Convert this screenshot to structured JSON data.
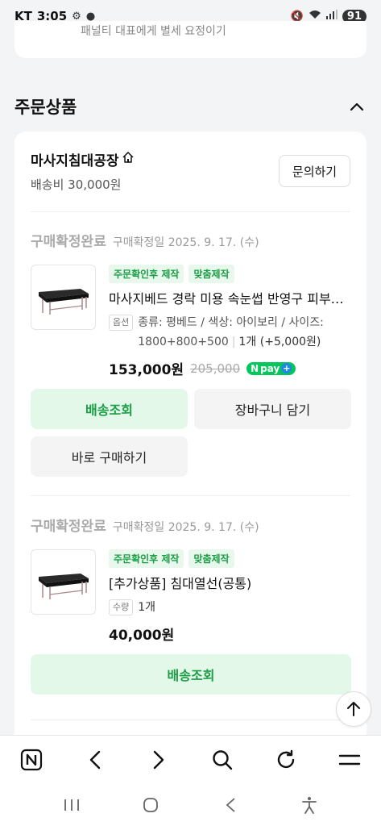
{
  "status_bar": {
    "carrier": "KT",
    "time": "3:05",
    "battery": "91"
  },
  "top_card": {
    "text": "패널티 대표에게 별세 요정이기"
  },
  "section": {
    "title": "주문상품"
  },
  "store": {
    "name": "마사지침대공장",
    "shipping_fee": "배송비 30,000원",
    "inquiry_label": "문의하기"
  },
  "orders": [
    {
      "status": "구매확정완료",
      "date": "구매확정일 2025. 9. 17. (수)",
      "tags": [
        "주문확인후 제작",
        "맞춤제작"
      ],
      "name": "마사지베드 경락 미용 속눈썹 반영구 피부관리 베드",
      "option_label": "옵션",
      "option_text": "종류: 평베드 / 색상: 아이보리 / 사이즈: 1800+800+500",
      "quantity": "1개 (+5,000원)",
      "price": "153,000원",
      "original_price": "205,000",
      "npay_label": "pay",
      "buttons": {
        "track": "배송조회",
        "cart": "장바구니 담기",
        "buy": "바로 구매하기"
      }
    },
    {
      "status": "구매확정완료",
      "date": "구매확정일 2025. 9. 17. (수)",
      "tags": [
        "주문확인후 제작",
        "맞춤제작"
      ],
      "name": "[추가상품] 침대열선(공통)",
      "option_label": "수량",
      "quantity": "1개",
      "price": "40,000원",
      "buttons": {
        "track": "배송조회"
      }
    }
  ],
  "colors": {
    "accent_green": "#1a9e45",
    "tag_bg": "#e8f8ec",
    "button_green_bg": "#e3f8e8",
    "npay_green": "#03c75a"
  }
}
